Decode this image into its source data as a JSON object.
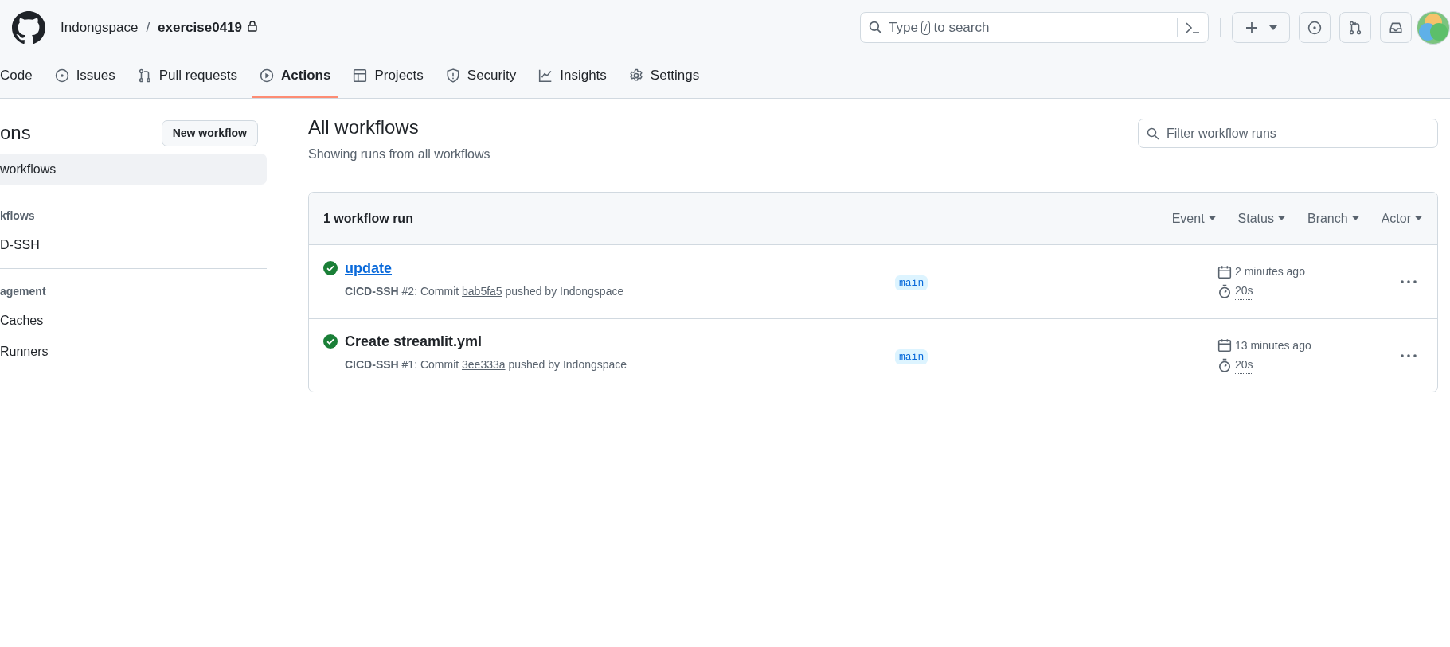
{
  "header": {
    "owner": "Indongspace",
    "separator": "/",
    "repo": "exercise0419",
    "private": true,
    "search": {
      "before": "Type",
      "key": "/",
      "after": "to search"
    }
  },
  "nav": [
    {
      "label": "Code",
      "selected": false
    },
    {
      "label": "Issues",
      "selected": false
    },
    {
      "label": "Pull requests",
      "selected": false
    },
    {
      "label": "Actions",
      "selected": true
    },
    {
      "label": "Projects",
      "selected": false
    },
    {
      "label": "Security",
      "selected": false
    },
    {
      "label": "Insights",
      "selected": false
    },
    {
      "label": "Settings",
      "selected": false
    }
  ],
  "sidebar": {
    "title": "ons",
    "new_button": "New workflow",
    "items": [
      {
        "label": "workflows",
        "selected": true
      }
    ],
    "sections": [
      {
        "heading": "kflows",
        "items": [
          {
            "label": "D-SSH",
            "selected": false
          }
        ]
      },
      {
        "heading": "agement",
        "items": [
          {
            "label": "Caches",
            "selected": false
          },
          {
            "label": "Runners",
            "selected": false
          }
        ]
      }
    ]
  },
  "main": {
    "title": "All workflows",
    "subtitle": "Showing runs from all workflows",
    "filter_placeholder": "Filter workflow runs",
    "run_count": "1 workflow run",
    "filters": [
      "Event",
      "Status",
      "Branch",
      "Actor"
    ],
    "runs": [
      {
        "kind": "success",
        "title": "update",
        "hovered": true,
        "summary": "**CICD-SSH** #2: Commit",
        "sha": "bab5fa5",
        "pushed": "pushed by Indongspace",
        "branch": "main",
        "time": "2 minutes ago",
        "duration": "20s"
      },
      {
        "kind": "success",
        "title": "Create streamlit.yml",
        "hovered": false,
        "summary": "**CICD-SSH** #1: Commit",
        "sha": "3ee333a",
        "pushed": "pushed by Indongspace",
        "branch": "main",
        "time": "13 minutes ago",
        "duration": "20s"
      }
    ]
  }
}
